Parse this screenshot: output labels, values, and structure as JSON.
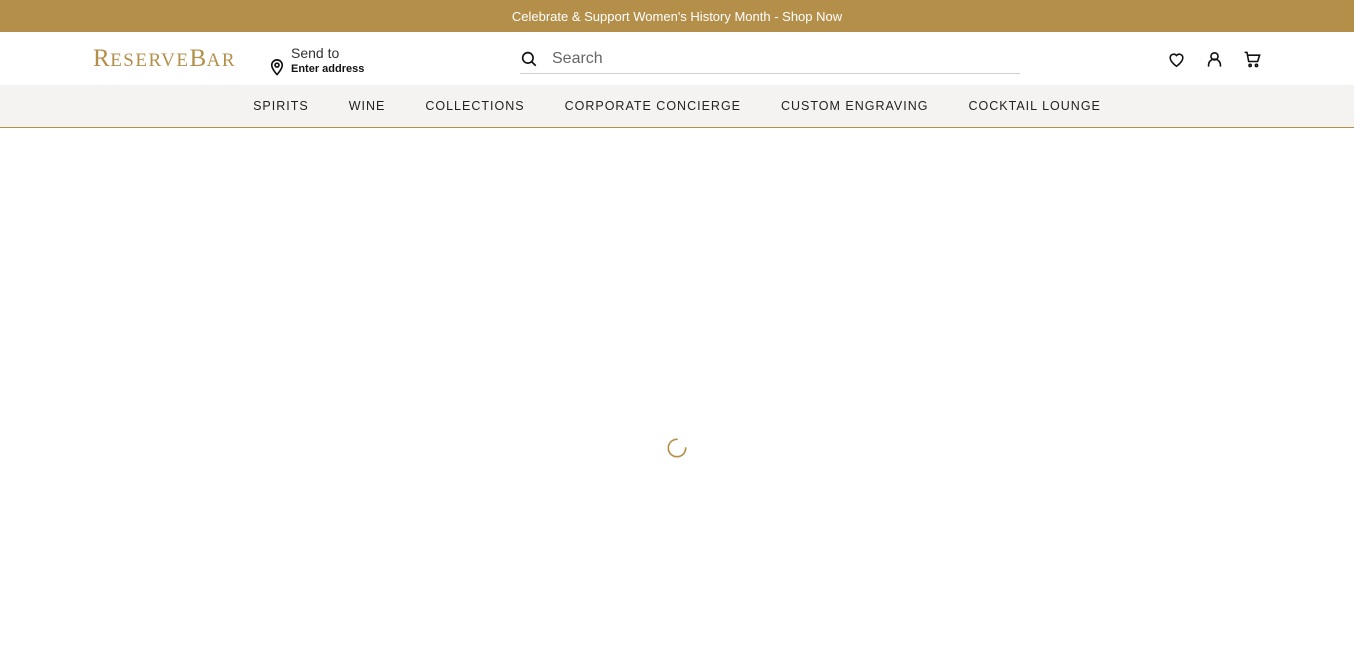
{
  "promo": {
    "text": "Celebrate & Support Women's History Month - Shop Now"
  },
  "header": {
    "logo_big_r": "R",
    "logo_small_1": "ESERVE",
    "logo_big_b": "B",
    "logo_small_2": "AR",
    "send_to_label": "Send to",
    "send_to_address": "Enter address",
    "search_placeholder": "Search",
    "icons": [
      "heart-icon",
      "user-icon",
      "cart-icon"
    ]
  },
  "nav": {
    "items": [
      "SPIRITS",
      "WINE",
      "COLLECTIONS",
      "CORPORATE CONCIERGE",
      "CUSTOM ENGRAVING",
      "COCKTAIL LOUNGE"
    ]
  },
  "colors": {
    "brand_gold": "#b38f4a",
    "nav_bg": "#f4f3f1"
  }
}
